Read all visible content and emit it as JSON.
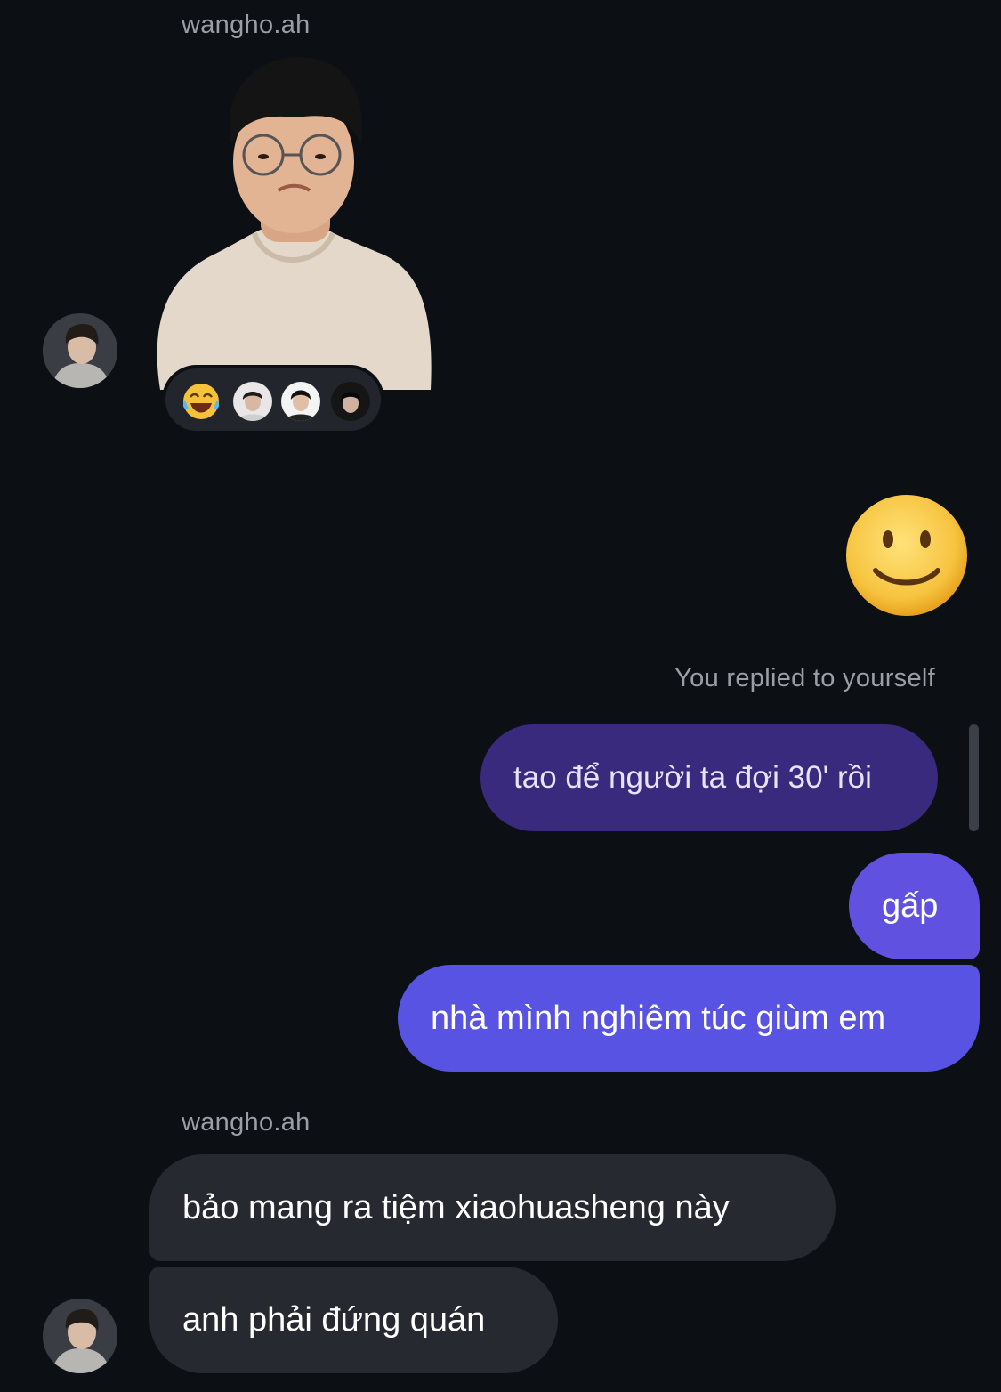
{
  "chat": {
    "first_group": {
      "sender_name": "wangho.ah",
      "sticker_icon": "person-sticker",
      "reactions": [
        {
          "kind": "emoji",
          "icon": "face-with-tears-of-joy-icon",
          "glyph": "😂"
        },
        {
          "kind": "avatar",
          "icon": "reactor-avatar-1"
        },
        {
          "kind": "avatar",
          "icon": "reactor-avatar-2"
        },
        {
          "kind": "avatar",
          "icon": "reactor-avatar-3"
        }
      ]
    },
    "outgoing_emoji": {
      "icon": "slightly-smiling-face-icon",
      "glyph": "🙂"
    },
    "reply_caption": "You replied to yourself",
    "replied_message": "tao để người ta đợi 30' rồi",
    "outgoing_messages": [
      "gấp",
      "nhà mình nghiêm túc giùm em"
    ],
    "second_group": {
      "sender_name": "wangho.ah",
      "messages": [
        "bảo mang ra tiệm xiaohuasheng này",
        "anh phải đứng quán"
      ]
    }
  },
  "colors": {
    "background": "#0c0f14",
    "incoming_bubble": "#26292f",
    "outgoing_bubble": "#5853e2",
    "reply_bubble": "#3a2a7e",
    "secondary_text": "#9a9ea6"
  }
}
